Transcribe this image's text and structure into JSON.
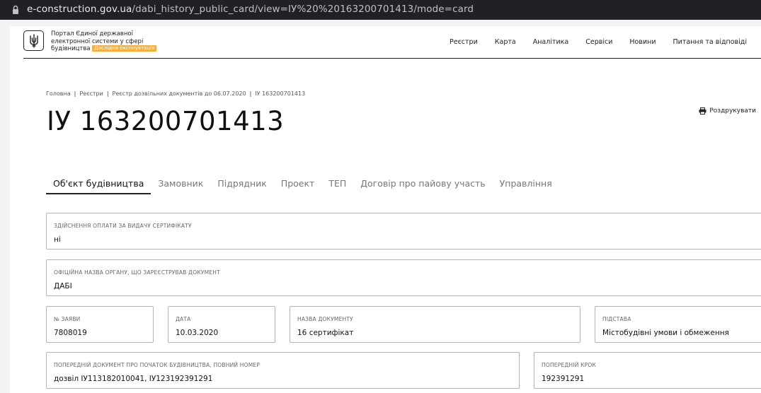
{
  "browser": {
    "url_host": "e-construction.gov.ua",
    "url_path": "/dabi_history_public_card/view=ІУ%20%20163200701413/mode=card"
  },
  "header": {
    "logo_line1": "Портал Єдиної державної",
    "logo_line2": "електронної системи у сфері",
    "logo_line3": "будівництва",
    "logo_badge": "Дослідна експлуатація",
    "nav": [
      "Реєстри",
      "Карта",
      "Аналітика",
      "Сервіси",
      "Новини",
      "Питання та відповіді"
    ]
  },
  "breadcrumb": [
    "Головна",
    "Реєстри",
    "Реєстр дозвільних документів до 06.07.2020",
    "ІУ 163200701413"
  ],
  "page_title": "ІУ 163200701413",
  "print_label": "Роздрукувати",
  "tabs": [
    "Об'єкт будівництва",
    "Замовник",
    "Підрядник",
    "Проект",
    "ТЕП",
    "Договір про пайову участь",
    "Управління"
  ],
  "active_tab": 0,
  "fields": {
    "payment": {
      "label": "Здійснення оплати за видачу сертифікату",
      "value": "ні"
    },
    "organ": {
      "label": "Офіційна назва органу, що зареєстрував документ",
      "value": "ДАБІ"
    },
    "app_no": {
      "label": "№ заяви",
      "value": "7808019"
    },
    "date": {
      "label": "Дата",
      "value": "10.03.2020"
    },
    "doc_name": {
      "label": "Назва документу",
      "value": "16 сертифікат"
    },
    "basis": {
      "label": "Підстава",
      "value": "Містобудівні умови і обмеження"
    },
    "prev_doc": {
      "label": "Попередній документ про початок будівництва, повний номер",
      "value": "дозвіл ІУ113182010041, ІУ123192391291"
    },
    "prev_step": {
      "label": "Попередній крок",
      "value": "192391291"
    }
  }
}
